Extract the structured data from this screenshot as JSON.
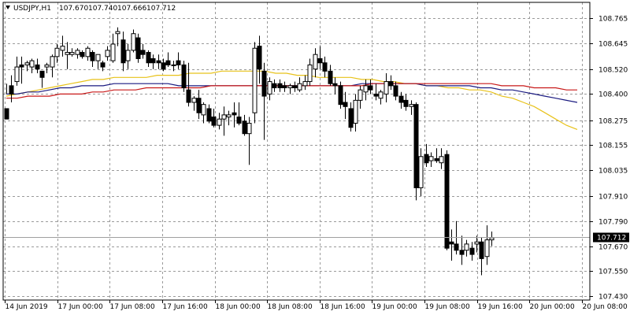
{
  "header": {
    "symbol": "USDJPY,H1",
    "open": "107.670",
    "high": "107.740",
    "low": "107.666",
    "close": "107.712",
    "icon": "triangle-down-icon"
  },
  "colors": {
    "background": "#ffffff",
    "grid": "#9a9a9a",
    "bull_body": "#ffffff",
    "bear_body": "#000000",
    "wick": "#000000",
    "ma_fast": "#e8c21a",
    "ma_mid": "#1a1a80",
    "ma_slow": "#c81818",
    "current_line": "#a0a0a0",
    "current_label_bg": "#000000",
    "current_label_text": "#ffffff"
  },
  "chart_data": {
    "type": "candlestick",
    "symbol": "USDJPY",
    "timeframe": "H1",
    "grid": true,
    "y_range": [
      107.43,
      108.81
    ],
    "y_ticks": [
      "108.765",
      "108.645",
      "108.520",
      "108.400",
      "108.275",
      "108.155",
      "108.035",
      "107.910",
      "107.790",
      "107.670",
      "107.550",
      "107.430"
    ],
    "x_ticks": [
      "14 Jun 2019",
      "17 Jun 00:00",
      "17 Jun 08:00",
      "17 Jun 16:00",
      "18 Jun 00:00",
      "18 Jun 08:00",
      "18 Jun 16:00",
      "19 Jun 00:00",
      "19 Jun 08:00",
      "19 Jun 16:00",
      "20 Jun 00:00",
      "20 Jun 08:00"
    ],
    "current_price": "107.712",
    "candles": [
      [
        108.33,
        108.45,
        108.4,
        108.28
      ],
      [
        108.44,
        108.49,
        108.36,
        108.4
      ],
      [
        108.46,
        108.58,
        108.44,
        108.53
      ],
      [
        108.54,
        108.58,
        108.45,
        108.53
      ],
      [
        108.54,
        108.56,
        108.51,
        108.55
      ],
      [
        108.53,
        108.57,
        108.5,
        108.56
      ],
      [
        108.54,
        108.57,
        108.5,
        108.52
      ],
      [
        108.51,
        108.51,
        108.43,
        108.48
      ],
      [
        108.53,
        108.55,
        108.5,
        108.54
      ],
      [
        108.53,
        108.59,
        108.48,
        108.58
      ],
      [
        108.58,
        108.64,
        108.55,
        108.62
      ],
      [
        108.61,
        108.68,
        108.58,
        108.63
      ],
      [
        108.59,
        108.65,
        108.52,
        108.6
      ],
      [
        108.59,
        108.62,
        108.58,
        108.6
      ],
      [
        108.59,
        108.62,
        108.57,
        108.61
      ],
      [
        108.6,
        108.61,
        108.57,
        108.58
      ],
      [
        108.58,
        108.63,
        108.56,
        108.62
      ],
      [
        108.6,
        108.61,
        108.53,
        108.56
      ],
      [
        108.56,
        108.59,
        108.52,
        108.59
      ],
      [
        108.55,
        108.56,
        108.51,
        108.53
      ],
      [
        108.58,
        108.63,
        108.56,
        108.61
      ],
      [
        108.56,
        108.69,
        108.55,
        108.64
      ],
      [
        108.69,
        108.72,
        108.63,
        108.7
      ],
      [
        108.66,
        108.7,
        108.51,
        108.55
      ],
      [
        108.56,
        108.64,
        108.52,
        108.61
      ],
      [
        108.61,
        108.71,
        108.6,
        108.69
      ],
      [
        108.67,
        108.69,
        108.55,
        108.57
      ],
      [
        108.61,
        108.64,
        108.57,
        108.59
      ],
      [
        108.6,
        108.61,
        108.53,
        108.55
      ],
      [
        108.57,
        108.59,
        108.52,
        108.55
      ],
      [
        108.56,
        108.59,
        108.52,
        108.55
      ],
      [
        108.55,
        108.57,
        108.51,
        108.52
      ],
      [
        108.56,
        108.6,
        108.53,
        108.54
      ],
      [
        108.54,
        108.56,
        108.51,
        108.54
      ],
      [
        108.56,
        108.6,
        108.52,
        108.54
      ],
      [
        108.54,
        108.56,
        108.41,
        108.43
      ],
      [
        108.42,
        108.55,
        108.34,
        108.36
      ],
      [
        108.36,
        108.39,
        108.32,
        108.38
      ],
      [
        108.38,
        108.42,
        108.28,
        108.31
      ],
      [
        108.3,
        108.36,
        108.26,
        108.35
      ],
      [
        108.33,
        108.35,
        108.26,
        108.27
      ],
      [
        108.29,
        108.33,
        108.24,
        108.25
      ],
      [
        108.25,
        108.31,
        108.23,
        108.28
      ],
      [
        108.28,
        108.34,
        108.2,
        108.3
      ],
      [
        108.29,
        108.32,
        108.25,
        108.3
      ],
      [
        108.31,
        108.36,
        108.24,
        108.3
      ],
      [
        108.29,
        108.36,
        108.25,
        108.26
      ],
      [
        108.27,
        108.3,
        108.2,
        108.21
      ],
      [
        108.21,
        108.29,
        108.06,
        108.26
      ],
      [
        108.31,
        108.65,
        108.26,
        108.62
      ],
      [
        108.63,
        108.68,
        108.45,
        108.52
      ],
      [
        108.51,
        108.55,
        108.18,
        108.39
      ],
      [
        108.4,
        108.48,
        108.37,
        108.46
      ],
      [
        108.45,
        108.47,
        108.41,
        108.43
      ],
      [
        108.45,
        108.47,
        108.41,
        108.43
      ],
      [
        108.44,
        108.46,
        108.41,
        108.43
      ],
      [
        108.43,
        108.45,
        108.4,
        108.44
      ],
      [
        108.44,
        108.46,
        108.41,
        108.43
      ],
      [
        108.42,
        108.48,
        108.41,
        108.45
      ],
      [
        108.44,
        108.49,
        108.42,
        108.46
      ],
      [
        108.46,
        108.57,
        108.44,
        108.54
      ],
      [
        108.52,
        108.62,
        108.48,
        108.59
      ],
      [
        108.57,
        108.63,
        108.52,
        108.55
      ],
      [
        108.55,
        108.58,
        108.48,
        108.51
      ],
      [
        108.51,
        108.54,
        108.44,
        108.45
      ],
      [
        108.45,
        108.48,
        108.4,
        108.44
      ],
      [
        108.44,
        108.46,
        108.33,
        108.35
      ],
      [
        108.36,
        108.41,
        108.28,
        108.34
      ],
      [
        108.33,
        108.36,
        108.22,
        108.24
      ],
      [
        108.26,
        108.4,
        108.22,
        108.37
      ],
      [
        108.37,
        108.44,
        108.33,
        108.42
      ],
      [
        108.41,
        108.47,
        108.37,
        108.44
      ],
      [
        108.44,
        108.47,
        108.4,
        108.42
      ],
      [
        108.4,
        108.45,
        108.37,
        108.39
      ],
      [
        108.38,
        108.42,
        108.35,
        108.41
      ],
      [
        108.4,
        108.5,
        108.36,
        108.46
      ],
      [
        108.46,
        108.49,
        108.42,
        108.44
      ],
      [
        108.44,
        108.46,
        108.37,
        108.39
      ],
      [
        108.39,
        108.41,
        108.33,
        108.36
      ],
      [
        108.37,
        108.4,
        108.32,
        108.34
      ],
      [
        108.34,
        108.37,
        108.3,
        108.35
      ],
      [
        108.35,
        108.36,
        107.89,
        107.95
      ],
      [
        107.95,
        108.14,
        107.91,
        108.1
      ],
      [
        108.11,
        108.16,
        108.05,
        108.07
      ],
      [
        108.08,
        108.12,
        108.05,
        108.1
      ],
      [
        108.09,
        108.14,
        108.07,
        108.08
      ],
      [
        108.07,
        108.14,
        108.04,
        108.1
      ],
      [
        108.11,
        108.13,
        107.65,
        107.66
      ],
      [
        107.69,
        107.75,
        107.6,
        107.68
      ],
      [
        107.68,
        107.79,
        107.63,
        107.65
      ],
      [
        107.65,
        107.72,
        107.58,
        107.63
      ],
      [
        107.65,
        107.7,
        107.62,
        107.68
      ],
      [
        107.66,
        107.69,
        107.6,
        107.63
      ],
      [
        107.68,
        107.72,
        107.64,
        107.69
      ],
      [
        107.69,
        107.71,
        107.53,
        107.61
      ],
      [
        107.62,
        107.77,
        107.58,
        107.7
      ],
      [
        107.7,
        107.74,
        107.67,
        107.71
      ]
    ],
    "moving_averages": [
      {
        "values": [
          108.39,
          108.4,
          108.41,
          108.42,
          108.43,
          108.44,
          108.45,
          108.46,
          108.47,
          108.47,
          108.48,
          108.48,
          108.48,
          108.48,
          108.49,
          108.49,
          108.49,
          108.5,
          108.5,
          108.5,
          108.51,
          108.51,
          108.51,
          108.51,
          108.51,
          108.5,
          108.5,
          108.49,
          108.49,
          108.48,
          108.48,
          108.48,
          108.48,
          108.47,
          108.47,
          108.46,
          108.46,
          108.45,
          108.45,
          108.44,
          108.44,
          108.43,
          108.43,
          108.42,
          108.42,
          108.41,
          108.39,
          108.38,
          108.36,
          108.34,
          108.31,
          108.28,
          108.25,
          108.23
        ]
      },
      {
        "values": [
          108.4,
          108.4,
          108.41,
          108.41,
          108.42,
          108.43,
          108.43,
          108.44,
          108.44,
          108.44,
          108.45,
          108.45,
          108.45,
          108.45,
          108.45,
          108.45,
          108.44,
          108.44,
          108.44,
          108.44,
          108.44,
          108.44,
          108.44,
          108.44,
          108.44,
          108.44,
          108.44,
          108.44,
          108.44,
          108.44,
          108.44,
          108.44,
          108.44,
          108.45,
          108.45,
          108.45,
          108.45,
          108.45,
          108.45,
          108.44,
          108.44,
          108.44,
          108.44,
          108.44,
          108.43,
          108.43,
          108.42,
          108.42,
          108.41,
          108.4,
          108.39,
          108.38,
          108.37,
          108.36
        ]
      },
      {
        "values": [
          108.38,
          108.38,
          108.39,
          108.39,
          108.39,
          108.4,
          108.4,
          108.4,
          108.41,
          108.41,
          108.42,
          108.42,
          108.42,
          108.43,
          108.43,
          108.43,
          108.43,
          108.43,
          108.43,
          108.44,
          108.44,
          108.44,
          108.44,
          108.44,
          108.44,
          108.44,
          108.44,
          108.44,
          108.44,
          108.44,
          108.44,
          108.44,
          108.44,
          108.44,
          108.45,
          108.45,
          108.45,
          108.45,
          108.45,
          108.45,
          108.45,
          108.45,
          108.45,
          108.45,
          108.45,
          108.45,
          108.44,
          108.44,
          108.44,
          108.43,
          108.43,
          108.43,
          108.42,
          108.42
        ]
      }
    ]
  }
}
